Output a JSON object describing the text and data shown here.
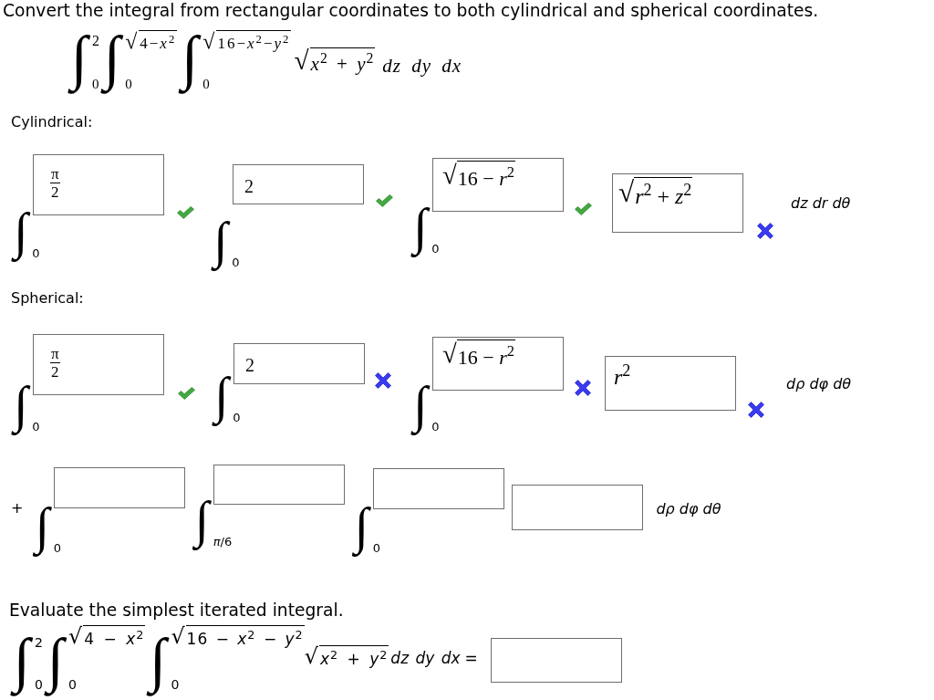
{
  "prompt": "Convert the integral from rectangular coordinates to both cylindrical and spherical coordinates.",
  "given_integral": {
    "integrals": [
      {
        "sign": "∫",
        "lower": "0",
        "upper": {
          "kind": "text",
          "value": "2"
        }
      },
      {
        "sign": "∫",
        "lower": "0",
        "upper": {
          "kind": "radical",
          "sign": "√",
          "radicand": "4−*x*$^{2}$"
        }
      },
      {
        "sign": "∫",
        "lower": "0",
        "upper": {
          "kind": "radical",
          "sign": "√",
          "radicand": "16−*x*$^{2}$−*y*$^{2}$"
        }
      }
    ],
    "integrand": {
      "sign": "√",
      "radicand": "*x*$^{2}$ + *y*$^{2}$"
    },
    "differentials": "dz dy dx"
  },
  "sections": [
    {
      "label": "Cylindrical:",
      "rows": [
        {
          "integrals": [
            {
              "sign": "∫",
              "lower": "0",
              "upper": {
                "kind": "fraction",
                "numerator": "π",
                "denominator": "2",
                "correct": true
              }
            },
            {
              "sign": "∫",
              "lower": "0",
              "upper": {
                "kind": "text",
                "value": "2",
                "correct": true
              }
            },
            {
              "sign": "∫",
              "lower": "0",
              "upper": {
                "kind": "radical",
                "sign": "√",
                "radicand": "16 − *r*$^{2}$",
                "correct": true
              }
            }
          ],
          "integrand": {
            "kind": "radical",
            "sign": "√",
            "radicand": "*r*$^{2}$ + *z*$^{2}$",
            "correct": false
          },
          "differentials": "dz dr dθ"
        }
      ]
    },
    {
      "label": "Spherical:",
      "rows": [
        {
          "integrals": [
            {
              "sign": "∫",
              "lower": "0",
              "upper": {
                "kind": "fraction",
                "numerator": "π",
                "denominator": "2",
                "correct": true
              }
            },
            {
              "sign": "∫",
              "lower": "0",
              "upper": {
                "kind": "text",
                "value": "2",
                "correct": false
              }
            },
            {
              "sign": "∫",
              "lower": "0",
              "upper": {
                "kind": "radical",
                "sign": "√",
                "radicand": "16 − *r*$^{2}$",
                "correct": false
              }
            }
          ],
          "integrand": {
            "kind": "text",
            "value": "*r*$^{2}$",
            "correct": false
          },
          "differentials": "dρ dφ dθ"
        },
        {
          "prefix": "+",
          "integrals": [
            {
              "sign": "∫",
              "lower": "0",
              "upper": {
                "kind": "blank"
              }
            },
            {
              "sign": "∫",
              "lower": "*π*/6",
              "upper": {
                "kind": "blank"
              }
            },
            {
              "sign": "∫",
              "lower": "0",
              "upper": {
                "kind": "blank"
              }
            }
          ],
          "integrand": {
            "kind": "blank"
          },
          "differentials": "dρ dφ dθ"
        }
      ]
    }
  ],
  "evaluate": {
    "prompt": "Evaluate the simplest iterated integral.",
    "integrals": [
      {
        "sign": "∫",
        "lower": "0",
        "upper": {
          "kind": "text",
          "value": "2"
        }
      },
      {
        "sign": "∫",
        "lower": "0",
        "upper": {
          "kind": "radical",
          "sign": "√",
          "radicand": "4 − *x*$^{2}$"
        }
      },
      {
        "sign": "∫",
        "lower": "0",
        "upper": {
          "kind": "radical",
          "sign": "√",
          "radicand": "16 − *x*$^{2}$ − *y*$^{2}$"
        }
      }
    ],
    "integrand": {
      "sign": "√",
      "radicand": "*x*$^{2}$ + *y*$^{2}$"
    },
    "differentials": "dz dy dx",
    "equals": "=",
    "answer": {
      "kind": "blank"
    }
  }
}
